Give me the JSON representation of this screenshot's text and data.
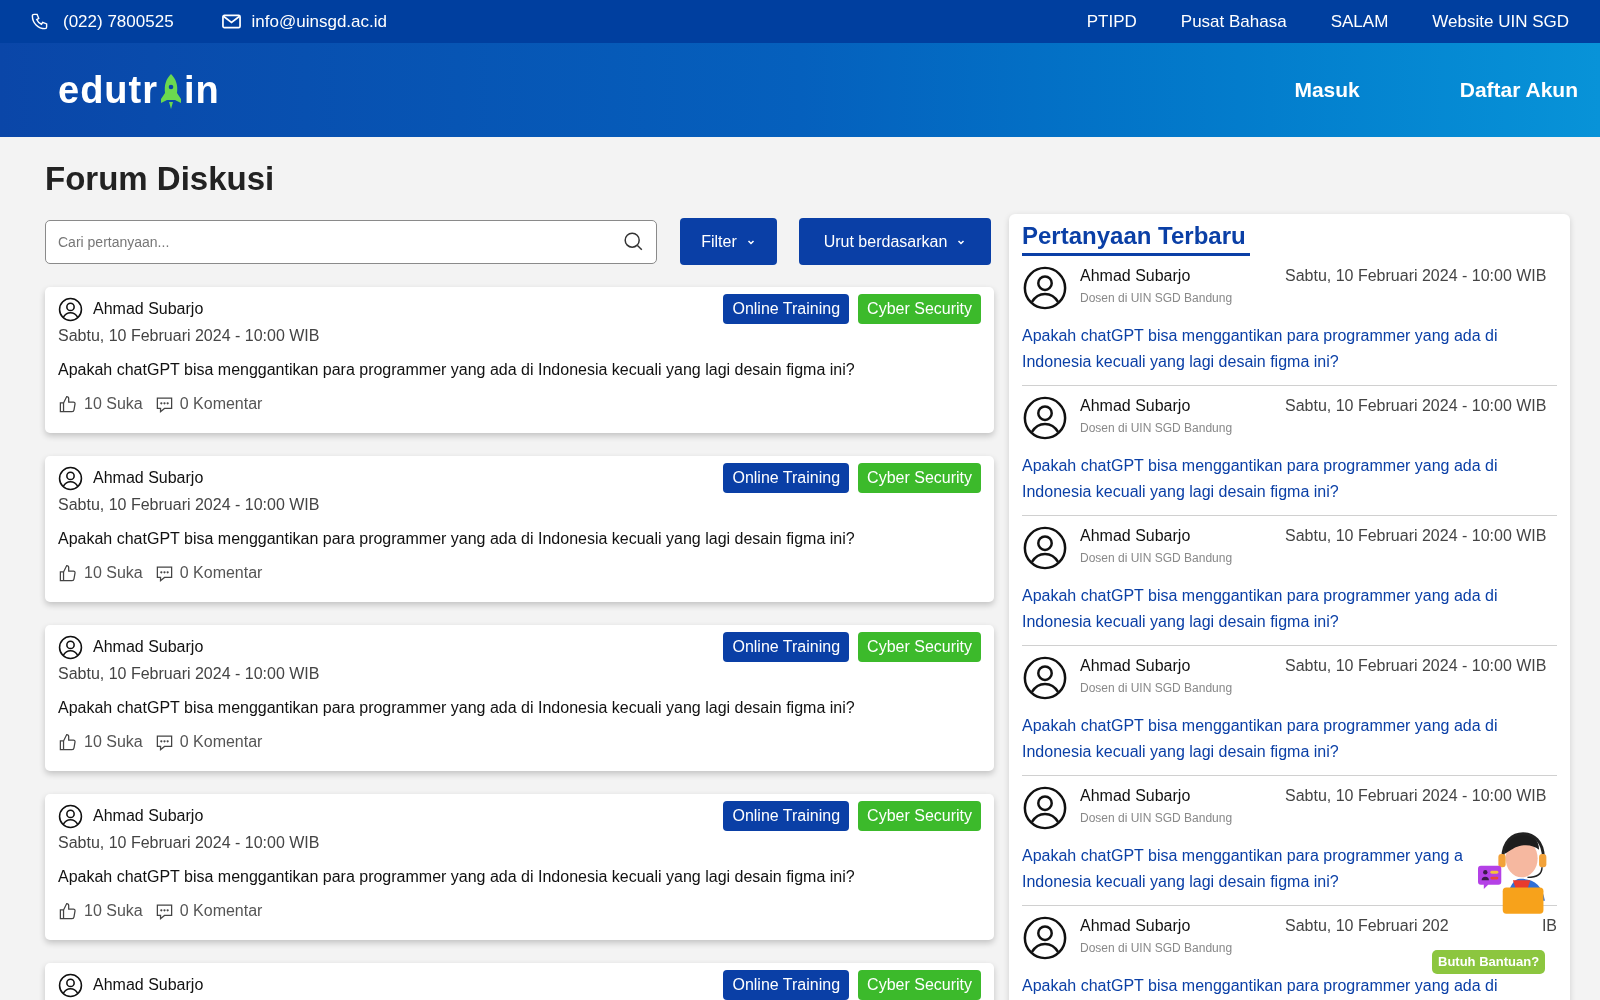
{
  "topbar": {
    "phone": "(022) 7800525",
    "email": "info@uinsgd.ac.id",
    "links": [
      "PTIPD",
      "Pusat Bahasa",
      "SALAM",
      "Website UIN SGD"
    ]
  },
  "header": {
    "logo": {
      "before": "edutr",
      "after": "in"
    },
    "actions": [
      "Masuk",
      "Daftar Akun"
    ]
  },
  "page_title": "Forum Diskusi",
  "search": {
    "placeholder": "Cari pertanyaan..."
  },
  "controls": [
    "Filter",
    "Urut berdasarkan"
  ],
  "posts": [
    {
      "author": "Ahmad Subarjo",
      "tags": [
        {
          "label": "Online Training",
          "color": "#0a3fa6"
        },
        {
          "label": "Cyber Security",
          "color": "#3cba2b"
        }
      ],
      "date": "Sabtu, 10 Februari 2024 - 10:00 WIB",
      "question": "Apakah chatGPT bisa menggantikan para programmer yang ada di Indonesia kecuali yang lagi desain figma ini?",
      "likes": "10 Suka",
      "comments": "0 Komentar"
    },
    {
      "author": "Ahmad Subarjo",
      "tags": [
        {
          "label": "Online Training",
          "color": "#0a3fa6"
        },
        {
          "label": "Cyber Security",
          "color": "#3cba2b"
        }
      ],
      "date": "Sabtu, 10 Februari 2024 - 10:00 WIB",
      "question": "Apakah chatGPT bisa menggantikan para programmer yang ada di Indonesia kecuali yang lagi desain figma ini?",
      "likes": "10 Suka",
      "comments": "0 Komentar"
    },
    {
      "author": "Ahmad Subarjo",
      "tags": [
        {
          "label": "Online Training",
          "color": "#0a3fa6"
        },
        {
          "label": "Cyber Security",
          "color": "#3cba2b"
        }
      ],
      "date": "Sabtu, 10 Februari 2024 - 10:00 WIB",
      "question": "Apakah chatGPT bisa menggantikan para programmer yang ada di Indonesia kecuali yang lagi desain figma ini?",
      "likes": "10 Suka",
      "comments": "0 Komentar"
    },
    {
      "author": "Ahmad Subarjo",
      "tags": [
        {
          "label": "Online Training",
          "color": "#0a3fa6"
        },
        {
          "label": "Cyber Security",
          "color": "#3cba2b"
        }
      ],
      "date": "Sabtu, 10 Februari 2024 - 10:00 WIB",
      "question": "Apakah chatGPT bisa menggantikan para programmer yang ada di Indonesia kecuali yang lagi desain figma ini?",
      "likes": "10 Suka",
      "comments": "0 Komentar"
    },
    {
      "author": "Ahmad Subarjo",
      "tags": [
        {
          "label": "Online Training",
          "color": "#0a3fa6"
        },
        {
          "label": "Cyber Security",
          "color": "#3cba2b"
        }
      ]
    }
  ],
  "recent": {
    "title": "Pertanyaan Terbaru",
    "items": [
      {
        "author": "Ahmad Subarjo",
        "role": "Dosen di UIN SGD Bandung",
        "date": "Sabtu, 10 Februari 2024 - 10:00 WIB",
        "question_lines": [
          "Apakah chatGPT bisa menggantikan para programmer yang ada di",
          "Indonesia kecuali yang lagi desain figma ini?"
        ]
      },
      {
        "author": "Ahmad Subarjo",
        "role": "Dosen di UIN SGD Bandung",
        "date": "Sabtu, 10 Februari 2024 - 10:00 WIB",
        "question_lines": [
          "Apakah chatGPT bisa menggantikan para programmer yang ada di",
          "Indonesia kecuali yang lagi desain figma ini?"
        ]
      },
      {
        "author": "Ahmad Subarjo",
        "role": "Dosen di UIN SGD Bandung",
        "date": "Sabtu, 10 Februari 2024 - 10:00 WIB",
        "question_lines": [
          "Apakah chatGPT bisa menggantikan para programmer yang ada di",
          "Indonesia kecuali yang lagi desain figma ini?"
        ]
      },
      {
        "author": "Ahmad Subarjo",
        "role": "Dosen di UIN SGD Bandung",
        "date": "Sabtu, 10 Februari 2024 - 10:00 WIB",
        "question_lines": [
          "Apakah chatGPT bisa menggantikan para programmer yang ada di",
          "Indonesia kecuali yang lagi desain figma ini?"
        ]
      },
      {
        "author": "Ahmad Subarjo",
        "role": "Dosen di UIN SGD Bandung",
        "date": "Sabtu, 10 Februari 2024 - 10:00 WIB",
        "question_lines": [
          "Apakah chatGPT bisa menggantikan para programmer yang a",
          "Indonesia kecuali yang lagi desain figma ini?"
        ]
      },
      {
        "author": "Ahmad Subarjo",
        "role": "Dosen di UIN SGD Bandung",
        "date": "Sabtu, 10 Februari 202",
        "date_tail": "IB",
        "question_lines": [
          "Apakah chatGPT bisa menggantikan para programmer yang ada di"
        ]
      }
    ]
  },
  "help_widget": {
    "label": "Butuh Bantuan?"
  }
}
